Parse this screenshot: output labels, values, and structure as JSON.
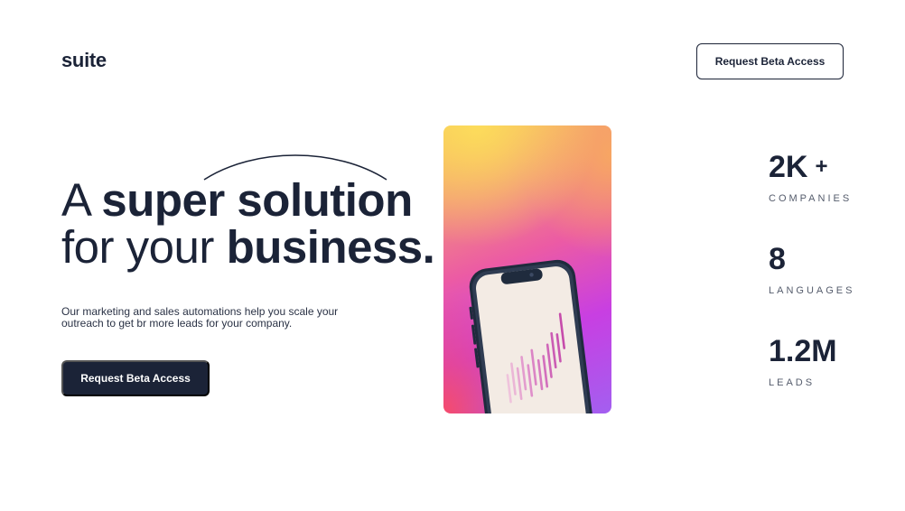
{
  "header": {
    "logo": "suite",
    "cta_label": "Request Beta Access"
  },
  "hero": {
    "headline_line1_light": "A",
    "headline_line1_bold": "super solution",
    "headline_line2_light": "for your",
    "headline_line2_bold": "business.",
    "description": "Our marketing and sales automations help you scale your outreach to get br more leads for your company.",
    "cta_label": "Request Beta Access"
  },
  "stats": [
    {
      "value": "2K",
      "suffix": "+",
      "label": "COMPANIES"
    },
    {
      "value": "8",
      "suffix": "",
      "label": "LANGUAGES"
    },
    {
      "value": "1.2M",
      "suffix": "",
      "label": "LEADS"
    }
  ],
  "colors": {
    "primary": "#1b2337",
    "background": "#ffffff",
    "muted": "#555c6c"
  },
  "icons": {
    "decorative_arc": "arc-decoration",
    "hero_image": "phone-with-chart-image"
  }
}
